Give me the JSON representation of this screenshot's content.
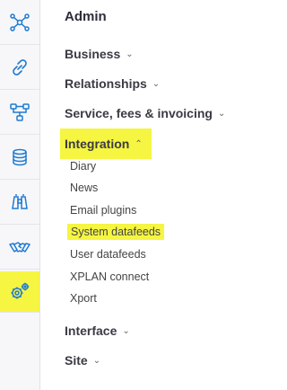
{
  "rail": {
    "icons": [
      "network-icon",
      "link-icon",
      "hierarchy-icon",
      "database-icon",
      "binoculars-icon",
      "handshake-icon",
      "gears-icon"
    ]
  },
  "admin": {
    "title": "Admin",
    "sections": [
      {
        "label": "Business",
        "expanded": false
      },
      {
        "label": "Relationships",
        "expanded": false
      },
      {
        "label": "Service, fees & invoicing",
        "expanded": false
      },
      {
        "label": "Integration",
        "expanded": true
      },
      {
        "label": "Interface",
        "expanded": false
      },
      {
        "label": "Site",
        "expanded": false
      }
    ],
    "integration_items": [
      "Diary",
      "News",
      "Email plugins",
      "System datafeeds",
      "User datafeeds",
      "XPLAN connect",
      "Xport"
    ]
  },
  "colors": {
    "icon_blue": "#1f7bd1",
    "highlight": "#f5f542"
  }
}
